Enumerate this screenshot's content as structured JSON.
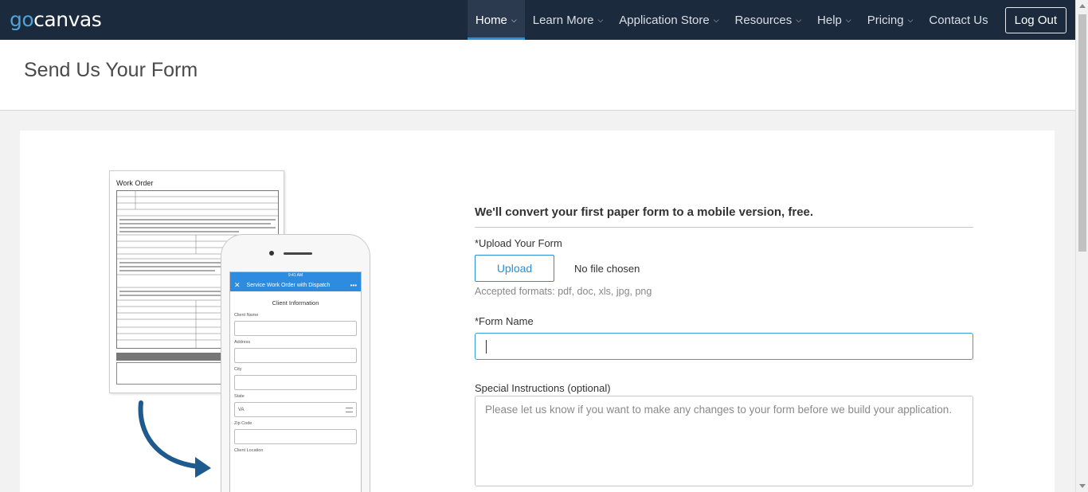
{
  "nav": {
    "logo_go": "go",
    "logo_rest": "canvas",
    "items": [
      {
        "label": "Home"
      },
      {
        "label": "Learn More"
      },
      {
        "label": "Application Store"
      },
      {
        "label": "Resources"
      },
      {
        "label": "Help"
      },
      {
        "label": "Pricing"
      },
      {
        "label": "Contact Us"
      }
    ],
    "active": "Home",
    "logout_label": "Log Out"
  },
  "page": {
    "title": "Send Us Your Form"
  },
  "illustration": {
    "paper_title": "Work Order",
    "phone_time": "9:41 AM",
    "phone_app_title": "Service Work Order with Dispatch",
    "phone_section": "Client Information",
    "phone_fields": [
      {
        "label": "Client Name",
        "value": ""
      },
      {
        "label": "Address",
        "value": ""
      },
      {
        "label": "City",
        "value": ""
      },
      {
        "label": "State",
        "value": "VA"
      },
      {
        "label": "Zip Code",
        "value": ""
      },
      {
        "label": "Client Location",
        "value": ""
      }
    ]
  },
  "form": {
    "lead": "We'll convert your first paper form to a mobile version, free.",
    "upload_label": "*Upload Your Form",
    "upload_button": "Upload",
    "file_status": "No file chosen",
    "formats": "Accepted formats: pdf, doc, xls, jpg, png",
    "name_label": "*Form Name",
    "name_value": "",
    "instructions_label": "Special Instructions (optional)",
    "instructions_placeholder": "Please let us know if you want to make any changes to your form before we build your application."
  },
  "colors": {
    "nav_bg": "#1b2a3c",
    "accent": "#2b8fd6",
    "logo_go": "#4fa3d9"
  }
}
